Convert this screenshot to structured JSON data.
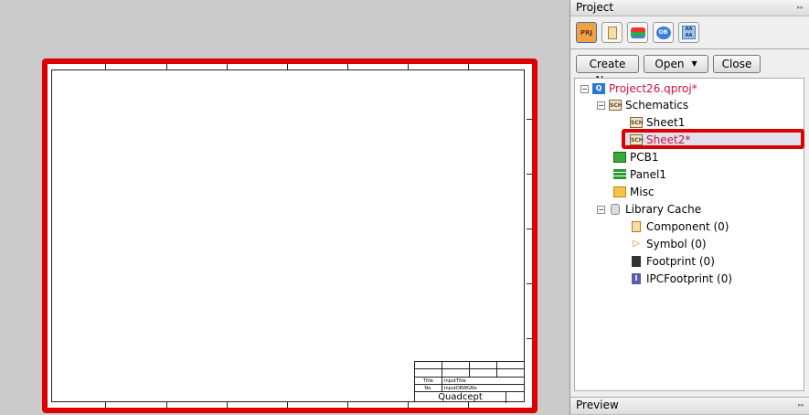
{
  "panel": {
    "title": "Project",
    "toolbar_icons": [
      "project-icon",
      "component-icon",
      "layers-icon",
      "ob-icon",
      "aa-icon"
    ],
    "buttons": {
      "create_new": "Create New",
      "open": "Open",
      "close": "Close"
    }
  },
  "tree": {
    "project": "Project26.qproj*",
    "schematics": "Schematics",
    "sheet1": "Sheet1",
    "sheet2": "Sheet2*",
    "pcb1": "PCB1",
    "panel1": "Panel1",
    "misc": "Misc",
    "library_cache": "Library Cache",
    "component": "Component (0)",
    "symbol": "Symbol (0)",
    "footprint": "Footprint (0)",
    "ipcfootprint": "IPCFootprint (0)"
  },
  "preview": {
    "title": "Preview"
  },
  "sheet": {
    "title_label": "Title",
    "no_label": "No.",
    "title_value": "InputTitle",
    "no_value": "InputDRWGNo",
    "logo": "Quadcept"
  },
  "colors": {
    "highlight": "#dd0000",
    "modified_text": "#d0103a"
  }
}
